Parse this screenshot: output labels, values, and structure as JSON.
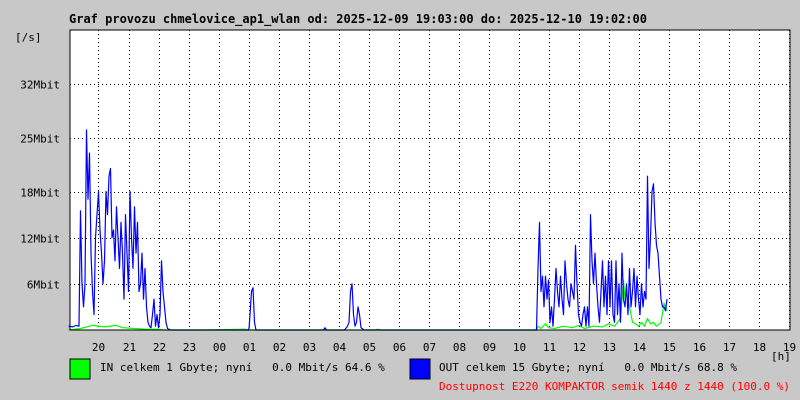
{
  "chart_data": {
    "type": "area",
    "title": "Graf provozu chmelovice_ap1_wlan od: 2025-12-09 19:03:00 do: 2025-12-10 19:02:00",
    "ylabel": "[/s]",
    "xlabel": "[h]",
    "grid": true,
    "legend_placement": "bottom",
    "ylim": [
      0,
      39
    ],
    "y_ticks": [
      {
        "value": 6,
        "label": "6Mbit"
      },
      {
        "value": 12,
        "label": "12Mbit"
      },
      {
        "value": 18,
        "label": "18Mbit"
      },
      {
        "value": 25,
        "label": "25Mbit"
      },
      {
        "value": 32,
        "label": "32Mbit"
      }
    ],
    "x_ticks": [
      "20",
      "21",
      "22",
      "23",
      "00",
      "01",
      "02",
      "03",
      "04",
      "05",
      "06",
      "07",
      "08",
      "09",
      "10",
      "11",
      "12",
      "13",
      "14",
      "15",
      "16",
      "17",
      "18",
      "19"
    ],
    "series": [
      {
        "name": "IN",
        "color": "#00ff00",
        "points": [
          [
            19.0,
            0
          ],
          [
            19.4,
            0.2
          ],
          [
            19.6,
            0.4
          ],
          [
            19.8,
            0.6
          ],
          [
            20.2,
            0.4
          ],
          [
            20.6,
            0.6
          ],
          [
            20.8,
            0.3
          ],
          [
            21.2,
            0.2
          ],
          [
            21.6,
            0.1
          ],
          [
            22.0,
            0.1
          ],
          [
            22.2,
            0
          ],
          [
            23.5,
            0
          ],
          [
            24.9,
            0.1
          ],
          [
            25.0,
            0
          ],
          [
            29.2,
            0
          ],
          [
            29.3,
            0.1
          ],
          [
            29.4,
            0
          ],
          [
            34.6,
            0
          ],
          [
            34.65,
            0.5
          ],
          [
            34.75,
            0.2
          ],
          [
            34.9,
            0.8
          ],
          [
            35.0,
            0.3
          ],
          [
            35.2,
            0.2
          ],
          [
            35.5,
            0.5
          ],
          [
            35.8,
            0.3
          ],
          [
            36.0,
            0.6
          ],
          [
            36.2,
            0.2
          ],
          [
            36.5,
            0.5
          ],
          [
            36.8,
            0.4
          ],
          [
            37.0,
            0.8
          ],
          [
            37.2,
            0.5
          ],
          [
            37.4,
            1.5
          ],
          [
            37.5,
            6.5
          ],
          [
            37.55,
            4.0
          ],
          [
            37.6,
            5.0
          ],
          [
            37.7,
            3.0
          ],
          [
            37.8,
            1.0
          ],
          [
            37.9,
            0.8
          ],
          [
            38.0,
            0.5
          ],
          [
            38.1,
            1.0
          ],
          [
            38.2,
            0.5
          ],
          [
            38.3,
            1.5
          ],
          [
            38.4,
            0.8
          ],
          [
            38.5,
            1.0
          ],
          [
            38.6,
            0.5
          ],
          [
            38.75,
            1.0
          ],
          [
            38.85,
            3.5
          ],
          [
            38.9,
            3.0
          ],
          [
            38.95,
            2.5
          ]
        ]
      },
      {
        "name": "OUT",
        "color": "#0000ff",
        "points": [
          [
            19.0,
            0.5
          ],
          [
            19.15,
            0.4
          ],
          [
            19.25,
            0.6
          ],
          [
            19.35,
            0.5
          ],
          [
            19.4,
            15.5
          ],
          [
            19.45,
            6
          ],
          [
            19.5,
            3
          ],
          [
            19.55,
            6
          ],
          [
            19.6,
            26
          ],
          [
            19.65,
            17
          ],
          [
            19.7,
            23
          ],
          [
            19.75,
            10
          ],
          [
            19.8,
            5
          ],
          [
            19.85,
            2
          ],
          [
            19.9,
            12
          ],
          [
            19.95,
            15
          ],
          [
            20.0,
            18
          ],
          [
            20.05,
            13
          ],
          [
            20.1,
            10
          ],
          [
            20.15,
            6
          ],
          [
            20.2,
            9
          ],
          [
            20.25,
            18
          ],
          [
            20.3,
            15
          ],
          [
            20.35,
            20
          ],
          [
            20.4,
            21
          ],
          [
            20.45,
            12
          ],
          [
            20.5,
            13
          ],
          [
            20.55,
            9
          ],
          [
            20.6,
            16
          ],
          [
            20.65,
            12
          ],
          [
            20.7,
            8
          ],
          [
            20.75,
            14
          ],
          [
            20.8,
            10
          ],
          [
            20.85,
            4
          ],
          [
            20.9,
            15
          ],
          [
            20.95,
            10
          ],
          [
            21.0,
            5
          ],
          [
            21.05,
            18
          ],
          [
            21.1,
            12
          ],
          [
            21.15,
            8
          ],
          [
            21.2,
            16
          ],
          [
            21.25,
            10
          ],
          [
            21.3,
            14
          ],
          [
            21.35,
            5
          ],
          [
            21.4,
            6
          ],
          [
            21.45,
            10
          ],
          [
            21.5,
            4
          ],
          [
            21.55,
            8
          ],
          [
            21.6,
            3
          ],
          [
            21.65,
            1
          ],
          [
            21.7,
            0.5
          ],
          [
            21.75,
            0.3
          ],
          [
            21.8,
            2
          ],
          [
            21.85,
            4
          ],
          [
            21.9,
            0.5
          ],
          [
            21.95,
            2
          ],
          [
            22.0,
            0.3
          ],
          [
            22.05,
            2
          ],
          [
            22.1,
            9
          ],
          [
            22.15,
            5
          ],
          [
            22.2,
            3
          ],
          [
            22.25,
            1
          ],
          [
            22.3,
            0.2
          ],
          [
            22.4,
            0
          ],
          [
            25.0,
            0
          ],
          [
            25.02,
            0.3
          ],
          [
            25.05,
            2
          ],
          [
            25.1,
            5
          ],
          [
            25.15,
            5.5
          ],
          [
            25.2,
            1
          ],
          [
            25.25,
            0
          ],
          [
            27.5,
            0
          ],
          [
            27.55,
            0.3
          ],
          [
            27.6,
            0
          ],
          [
            28.2,
            0
          ],
          [
            28.3,
            0.5
          ],
          [
            28.35,
            1
          ],
          [
            28.4,
            5
          ],
          [
            28.45,
            6
          ],
          [
            28.5,
            2
          ],
          [
            28.55,
            0.5
          ],
          [
            28.6,
            1
          ],
          [
            28.65,
            3
          ],
          [
            28.7,
            2
          ],
          [
            28.75,
            0.3
          ],
          [
            28.85,
            0
          ],
          [
            34.6,
            0
          ],
          [
            34.65,
            8
          ],
          [
            34.7,
            14
          ],
          [
            34.75,
            5
          ],
          [
            34.8,
            7
          ],
          [
            34.85,
            3
          ],
          [
            34.9,
            7
          ],
          [
            34.95,
            4
          ],
          [
            35.0,
            6.5
          ],
          [
            35.05,
            1
          ],
          [
            35.1,
            3
          ],
          [
            35.15,
            0.5
          ],
          [
            35.2,
            4
          ],
          [
            35.25,
            8
          ],
          [
            35.3,
            5
          ],
          [
            35.35,
            3
          ],
          [
            35.4,
            7
          ],
          [
            35.45,
            4
          ],
          [
            35.5,
            2
          ],
          [
            35.55,
            9
          ],
          [
            35.6,
            6
          ],
          [
            35.65,
            4
          ],
          [
            35.7,
            3
          ],
          [
            35.75,
            6
          ],
          [
            35.8,
            5
          ],
          [
            35.85,
            4
          ],
          [
            35.9,
            11
          ],
          [
            35.95,
            6
          ],
          [
            36.0,
            2
          ],
          [
            36.05,
            1
          ],
          [
            36.1,
            0.5
          ],
          [
            36.15,
            2
          ],
          [
            36.2,
            3
          ],
          [
            36.25,
            0.5
          ],
          [
            36.3,
            3
          ],
          [
            36.35,
            0.5
          ],
          [
            36.4,
            15
          ],
          [
            36.45,
            9
          ],
          [
            36.5,
            6
          ],
          [
            36.55,
            10
          ],
          [
            36.6,
            6
          ],
          [
            36.65,
            3
          ],
          [
            36.7,
            1
          ],
          [
            36.75,
            5
          ],
          [
            36.8,
            9
          ],
          [
            36.85,
            3
          ],
          [
            36.9,
            7
          ],
          [
            36.95,
            2
          ],
          [
            37.0,
            9
          ],
          [
            37.05,
            3
          ],
          [
            37.1,
            9
          ],
          [
            37.15,
            2
          ],
          [
            37.2,
            1
          ],
          [
            37.25,
            9
          ],
          [
            37.3,
            2
          ],
          [
            37.35,
            6
          ],
          [
            37.4,
            1
          ],
          [
            37.45,
            10
          ],
          [
            37.5,
            4
          ],
          [
            37.55,
            3
          ],
          [
            37.6,
            6
          ],
          [
            37.65,
            2
          ],
          [
            37.7,
            8
          ],
          [
            37.75,
            3
          ],
          [
            37.8,
            5
          ],
          [
            37.85,
            8
          ],
          [
            37.9,
            3
          ],
          [
            37.95,
            7
          ],
          [
            38.0,
            4
          ],
          [
            38.05,
            2
          ],
          [
            38.1,
            6
          ],
          [
            38.15,
            3
          ],
          [
            38.2,
            5
          ],
          [
            38.25,
            4
          ],
          [
            38.3,
            20
          ],
          [
            38.35,
            8
          ],
          [
            38.4,
            12
          ],
          [
            38.45,
            18
          ],
          [
            38.5,
            19
          ],
          [
            38.55,
            14
          ],
          [
            38.6,
            11
          ],
          [
            38.65,
            10
          ],
          [
            38.7,
            7
          ],
          [
            38.75,
            4
          ],
          [
            38.8,
            3
          ],
          [
            38.85,
            3
          ],
          [
            38.9,
            2.5
          ],
          [
            38.95,
            4
          ]
        ]
      }
    ]
  },
  "legend": {
    "in_text": "IN celkem 1 Gbyte; nyní   0.0 Mbit/s 64.6 %",
    "out_text": "OUT celkem 15 Gbyte; nyní   0.0 Mbit/s 68.8 %",
    "availability_text": "Dostupnost E220 KOMPAKTOR semik 1440 z 1440 (100.0 %)",
    "availability_color": "#ff0000"
  }
}
